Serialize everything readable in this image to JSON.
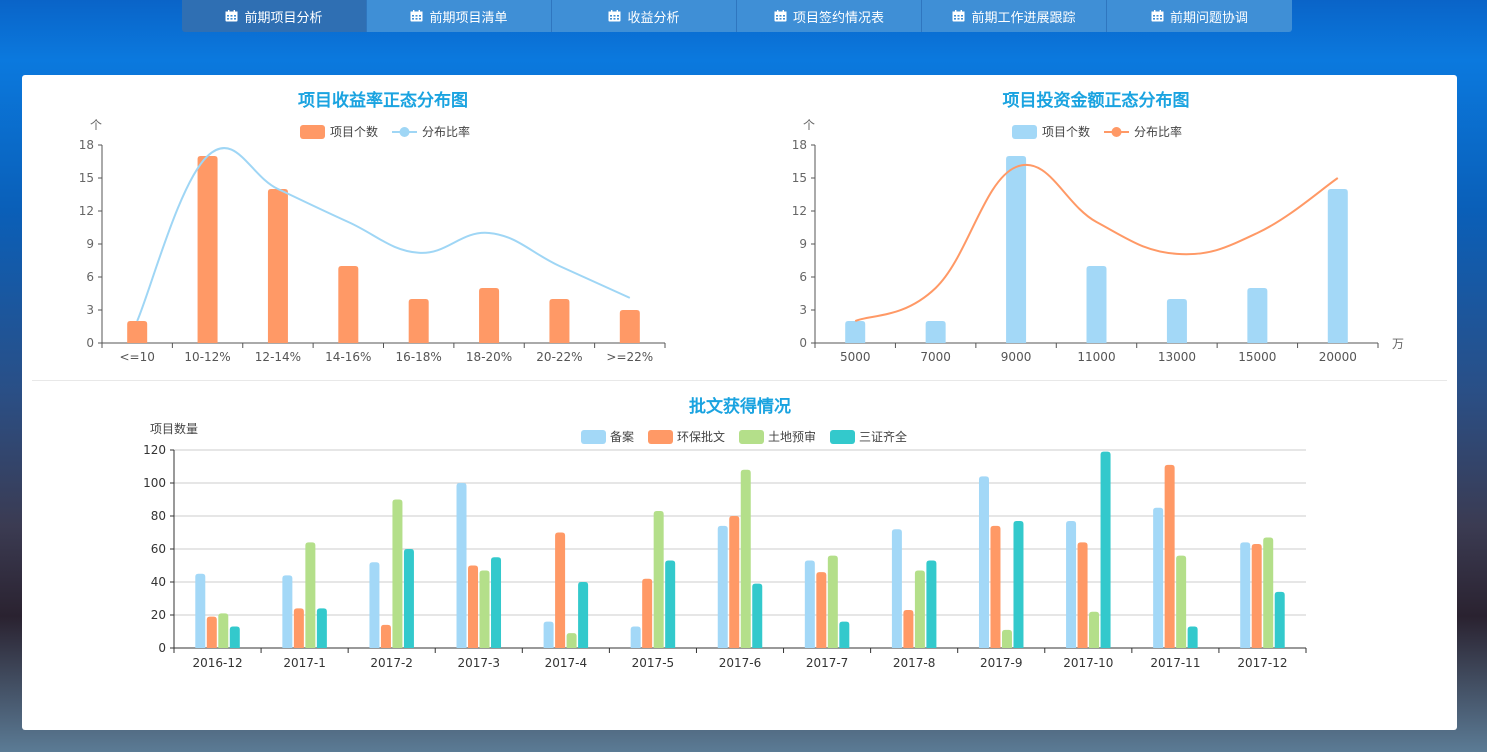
{
  "nav": {
    "items": [
      "前期项目分析",
      "前期项目清单",
      "收益分析",
      "项目签约情况表",
      "前期工作进展跟踪",
      "前期问题协调"
    ],
    "active_index": 0,
    "icon": "calendar-icon"
  },
  "chart_data": [
    {
      "type": "bar",
      "title": "项目收益率正态分布图",
      "ylabel": "个",
      "xlabel": "",
      "ylim": [
        0,
        18
      ],
      "yticks": [
        0,
        3,
        6,
        9,
        12,
        15,
        18
      ],
      "categories": [
        "<=10",
        "10-12%",
        "12-14%",
        "14-16%",
        "16-18%",
        "18-20%",
        "20-22%",
        ">=22%"
      ],
      "series": [
        {
          "name": "项目个数",
          "kind": "bar",
          "color": "#ff9966",
          "values": [
            2,
            17,
            14,
            7,
            4,
            5,
            4,
            3
          ]
        },
        {
          "name": "分布比率",
          "kind": "line",
          "color": "#9fd6f5",
          "values": [
            2,
            17,
            14,
            11,
            8.2,
            10,
            7,
            4.1
          ]
        }
      ],
      "legend": "top-center",
      "grid": false
    },
    {
      "type": "bar",
      "title": "项目投资金额正态分布图",
      "ylabel": "个",
      "xlabel": "万",
      "ylim": [
        0,
        18
      ],
      "yticks": [
        0,
        3,
        6,
        9,
        12,
        15,
        18
      ],
      "categories": [
        "5000",
        "7000",
        "9000",
        "11000",
        "13000",
        "15000",
        "20000"
      ],
      "series": [
        {
          "name": "项目个数",
          "kind": "bar",
          "color": "#a3d8f7",
          "values": [
            2,
            2,
            17,
            7,
            4,
            5,
            14
          ]
        },
        {
          "name": "分布比率",
          "kind": "line",
          "color": "#ff9966",
          "values": [
            2,
            5,
            16,
            11,
            8.1,
            10,
            15
          ]
        }
      ],
      "legend": "top-center",
      "grid": false
    },
    {
      "type": "bar",
      "title": "批文获得情况",
      "ylabel": "项目数量",
      "xlabel": "",
      "ylim": [
        0,
        120
      ],
      "yticks": [
        0,
        20,
        40,
        60,
        80,
        100,
        120
      ],
      "categories": [
        "2016-12",
        "2017-1",
        "2017-2",
        "2017-3",
        "2017-4",
        "2017-5",
        "2017-6",
        "2017-7",
        "2017-8",
        "2017-9",
        "2017-10",
        "2017-11",
        "2017-12"
      ],
      "series": [
        {
          "name": "备案",
          "color": "#a3d8f7",
          "values": [
            45,
            44,
            52,
            100,
            16,
            13,
            74,
            53,
            72,
            104,
            77,
            85,
            64
          ]
        },
        {
          "name": "环保批文",
          "color": "#ff9966",
          "values": [
            19,
            24,
            14,
            50,
            70,
            42,
            80,
            46,
            23,
            74,
            64,
            111,
            63
          ]
        },
        {
          "name": "土地预审",
          "color": "#b4df8a",
          "values": [
            21,
            64,
            90,
            47,
            9,
            83,
            108,
            56,
            47,
            11,
            22,
            56,
            67
          ]
        },
        {
          "name": "三证齐全",
          "color": "#33c9cc",
          "values": [
            13,
            24,
            60,
            55,
            40,
            53,
            39,
            16,
            53,
            77,
            119,
            13,
            34
          ]
        }
      ],
      "legend": "top-center",
      "grid": true
    }
  ]
}
